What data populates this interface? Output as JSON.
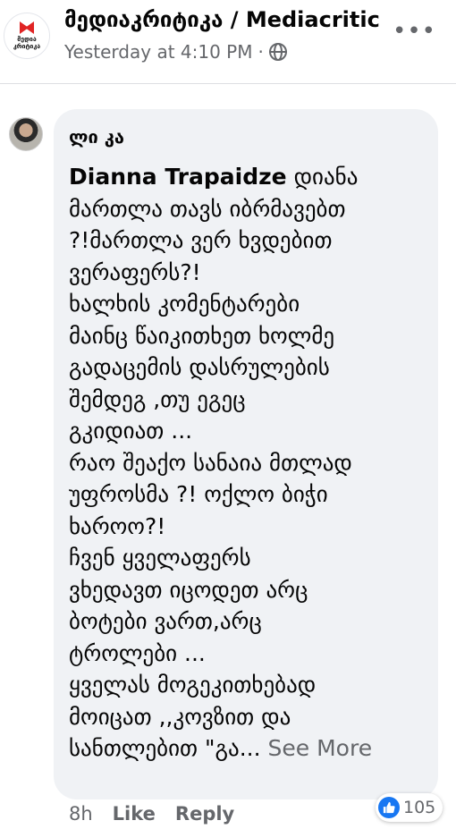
{
  "post": {
    "page_logo_text_line1": "მედია",
    "page_logo_text_line2": "კრიტიკა",
    "page_name": "მედიაკრიტიკა / Mediacritic",
    "timestamp": "Yesterday at 4:10 PM",
    "separator": "·",
    "privacy_icon": "globe-icon",
    "more_icon": "more-options-icon"
  },
  "comment": {
    "author": "ლი კა",
    "tagged_name": "Dianna Trapaidze",
    "lines": [
      "დიანა",
      "მართლა თავს იბრმავებთ",
      "?!მართლა ვერ ხვდებით",
      "ვერაფერს?!",
      "ხალხის კომენტარები",
      "მაინც წაიკითხეთ ხოლმე",
      "გადაცემის დასრულების",
      "შემდეგ ,თუ ეგეც",
      "გკიდიათ ...",
      "რაო შეაქო სანაია მთლად",
      "უფროსმა ?! ოქლო ბიჭი",
      "ხაროო?!",
      "ჩვენ ყველაფერს",
      "ვხედავთ იცოდეთ არც",
      "ბოტები ვართ,არც",
      "ტროლები ...",
      "ყველას მოგეკითხებად",
      "მოიცათ ,,კოვზით და",
      "სანთლებით \"გა..."
    ],
    "see_more": "See More",
    "age": "8h",
    "like_label": "Like",
    "reply_label": "Reply",
    "reaction_icon": "like-icon",
    "reaction_count": "105"
  },
  "colors": {
    "bubble_bg": "#f0f2f5",
    "secondary_text": "#65676b",
    "like_blue": "#1877f2",
    "logo_red": "#e02424"
  }
}
